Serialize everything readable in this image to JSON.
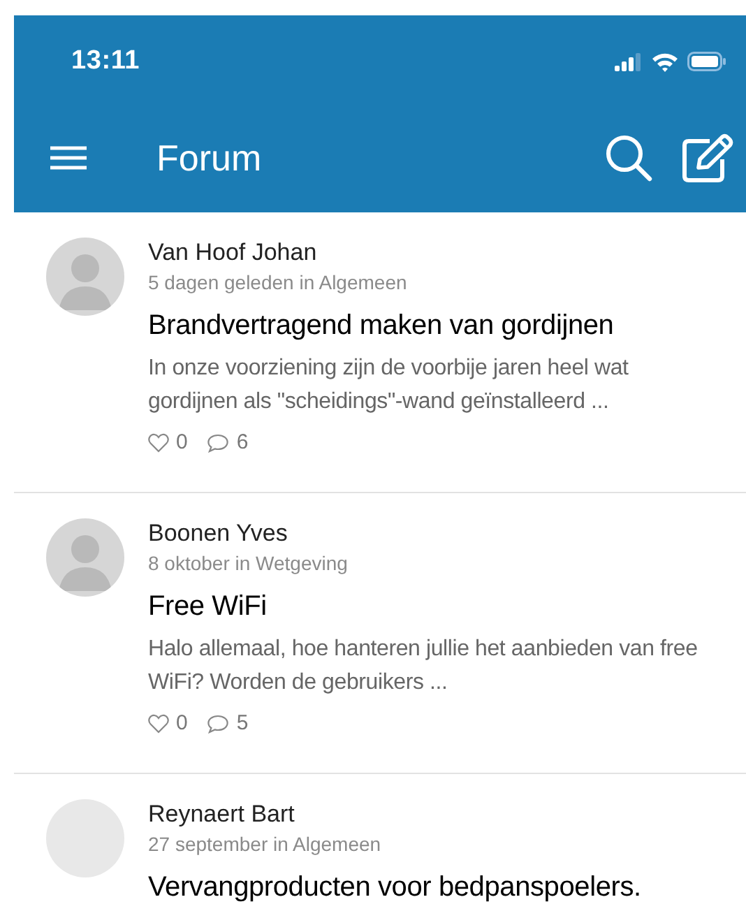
{
  "status_bar": {
    "time": "13:11"
  },
  "nav_bar": {
    "title": "Forum"
  },
  "posts": [
    {
      "kind": "photo",
      "author": "Van Hoof Johan",
      "meta": "5 dagen geleden in Algemeen",
      "title": "Brandvertragend maken van gordijnen",
      "excerpt": "In onze voorziening zijn de voorbije jaren heel wat gordijnen als \"scheidings\"-wand geïnstalleerd ...",
      "likes": "0",
      "comments": "6"
    },
    {
      "kind": "photo",
      "author": "Boonen Yves",
      "meta": "8 oktober in Wetgeving",
      "title": "Free WiFi",
      "excerpt": "Halo allemaal, hoe hanteren jullie het aanbieden van free WiFi? Worden de gebruikers ...",
      "likes": "0",
      "comments": "5"
    },
    {
      "kind": "empty",
      "author": "Reynaert Bart",
      "meta": "27 september in Algemeen",
      "title": "Vervangproducten voor bedpanspoelers."
    }
  ]
}
